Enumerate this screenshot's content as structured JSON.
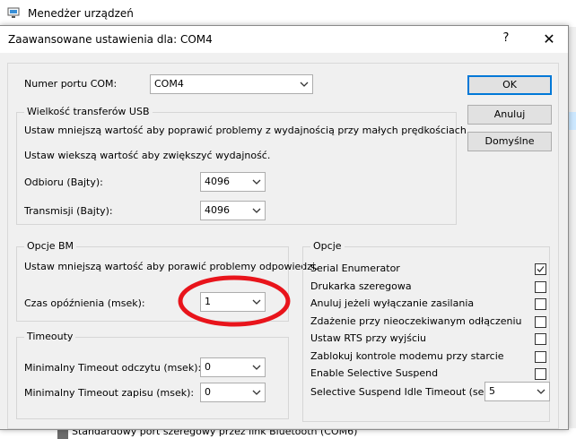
{
  "background": {
    "title": "Menedżer urządzeń",
    "bottom_item": "Standardowy port szeregowy przez link Bluetooth (COM6)"
  },
  "dialog": {
    "title": "Zaawansowane ustawienia dla: COM4",
    "help": "?",
    "close": "✕"
  },
  "com_port": {
    "label": "Numer portu COM:",
    "value": "COM4"
  },
  "usb": {
    "title": "Wielkość transferów USB",
    "hint1": "Ustaw mniejszą wartość aby poprawić problemy z wydajnością przy małych prędkościach.",
    "hint2": "Ustaw wiekszą wartość aby zwiększyć wydajność.",
    "rx_label": "Odbioru (Bajty):",
    "rx_value": "4096",
    "tx_label": "Transmisji (Bajty):",
    "tx_value": "4096"
  },
  "bm": {
    "title": "Opcje BM",
    "hint": "Ustaw mniejszą wartość aby porawić problemy odpowiedzi.",
    "latency_label": "Czas opóźnienia (msek):",
    "latency_value": "1"
  },
  "timeouts": {
    "title": "Timeouty",
    "read_label": "Minimalny Timeout odczytu (msek):",
    "read_value": "0",
    "write_label": "Minimalny Timeout zapisu (msek):",
    "write_value": "0"
  },
  "options": {
    "title": "Opcje",
    "items": [
      {
        "label": "Serial Enumerator",
        "checked": true
      },
      {
        "label": "Drukarka szeregowa",
        "checked": false
      },
      {
        "label": "Anuluj jeżeli wyłączanie zasilania",
        "checked": false
      },
      {
        "label": "Zdażenie przy nieoczekiwanym odłączeniu",
        "checked": false
      },
      {
        "label": "Ustaw RTS przy wyjściu",
        "checked": false
      },
      {
        "label": "Zablokuj kontrole modemu przy starcie",
        "checked": false
      },
      {
        "label": "Enable Selective Suspend",
        "checked": false
      }
    ],
    "idle_label": "Selective Suspend Idle Timeout (secs):",
    "idle_value": "5"
  },
  "buttons": {
    "ok": "OK",
    "cancel": "Anuluj",
    "defaults": "Domyślne"
  },
  "colors": {
    "accent": "#0078d7",
    "annotation": "#e8141b"
  }
}
